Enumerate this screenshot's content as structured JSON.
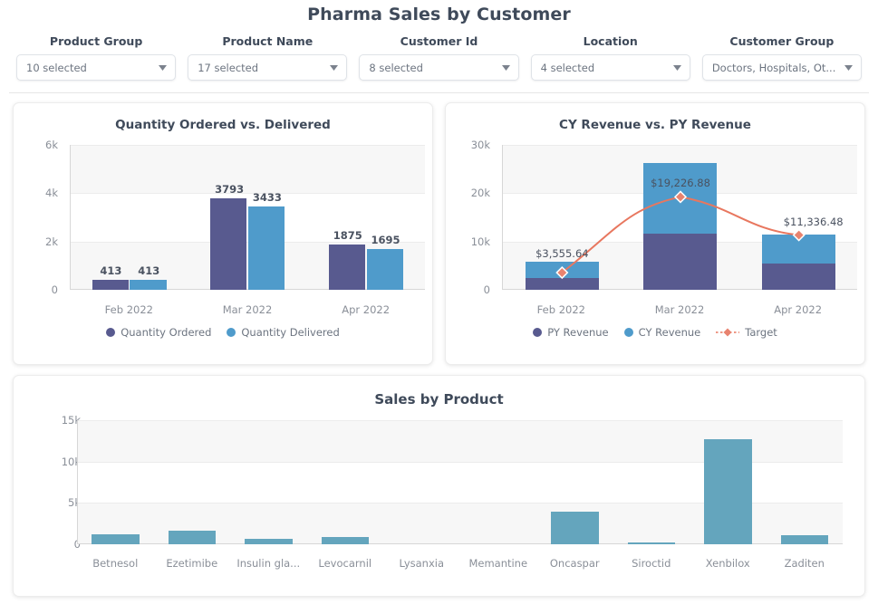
{
  "header": {
    "title": "Pharma Sales by Customer"
  },
  "filters": [
    {
      "label": "Product Group",
      "value": "10 selected",
      "icon": "chevron-down-icon"
    },
    {
      "label": "Product Name",
      "value": "17 selected",
      "icon": "chevron-down-icon"
    },
    {
      "label": "Customer Id",
      "value": "8 selected",
      "icon": "chevron-down-icon"
    },
    {
      "label": "Location",
      "value": "4 selected",
      "icon": "chevron-down-icon"
    },
    {
      "label": "Customer Group",
      "value": "Doctors, Hospitals, Ot...",
      "icon": "chevron-down-icon"
    }
  ],
  "colors": {
    "purple": "#585a8f",
    "blue": "#4f9bcb",
    "teal": "#64a5bd",
    "target": "#e8775f",
    "title": "#3f4a5a",
    "axis": "#8a8f98",
    "band": "#f7f7f7"
  },
  "chart_data": [
    {
      "type": "bar",
      "id": "quantity-ordered-vs-delivered",
      "title": "Quantity Ordered vs. Delivered",
      "xlabel": "",
      "ylabel": "",
      "ylim": [
        0,
        6000
      ],
      "yticks": [
        0,
        2000,
        4000,
        6000
      ],
      "ytick_labels": [
        "0",
        "2k",
        "4k",
        "6k"
      ],
      "grid": true,
      "legend_position": "bottom",
      "categories": [
        "Feb 2022",
        "Mar 2022",
        "Apr 2022"
      ],
      "series": [
        {
          "name": "Quantity Ordered",
          "color": "#585a8f",
          "values": [
            413,
            3793,
            1875
          ],
          "labels": [
            "413",
            "3793",
            "1875"
          ]
        },
        {
          "name": "Quantity Delivered",
          "color": "#4f9bcb",
          "values": [
            413,
            3433,
            1695
          ],
          "labels": [
            "413",
            "3433",
            "1695"
          ]
        }
      ]
    },
    {
      "type": "bar",
      "id": "cy-revenue-vs-py-revenue",
      "title": "CY Revenue vs. PY Revenue",
      "stacked": true,
      "xlabel": "",
      "ylabel": "",
      "ylim": [
        0,
        30000
      ],
      "yticks": [
        0,
        10000,
        20000,
        30000
      ],
      "ytick_labels": [
        "0",
        "10k",
        "20k",
        "30k"
      ],
      "grid": true,
      "legend_position": "bottom",
      "categories": [
        "Feb 2022",
        "Mar 2022",
        "Apr 2022"
      ],
      "series": [
        {
          "name": "PY Revenue",
          "color": "#585a8f",
          "values": [
            2400,
            11700,
            5500
          ]
        },
        {
          "name": "CY Revenue",
          "color": "#4f9bcb",
          "values": [
            3500,
            14500,
            5900
          ]
        },
        {
          "name": "Target",
          "color": "#e8775f",
          "type": "line",
          "marker": "diamond",
          "values": [
            3555.64,
            19226.88,
            11336.48
          ],
          "labels": [
            "$3,555.64",
            "$19,226.88",
            "$11,336.48"
          ]
        }
      ]
    },
    {
      "type": "bar",
      "id": "sales-by-product",
      "title": "Sales by Product",
      "xlabel": "",
      "ylabel": "",
      "ylim": [
        0,
        15000
      ],
      "yticks": [
        0,
        5000,
        10000,
        15000
      ],
      "ytick_labels": [
        "0",
        "5k",
        "10k",
        "15k"
      ],
      "grid": true,
      "legend_position": "none",
      "categories": [
        "Betnesol",
        "Ezetimibe",
        "Insulin gla...",
        "Levocarnil",
        "Lysanxia",
        "Memantine",
        "Oncaspar",
        "Siroctid",
        "Xenbilox",
        "Zaditen"
      ],
      "series": [
        {
          "name": "Sales",
          "color": "#64a5bd",
          "values": [
            1250,
            1650,
            650,
            900,
            0,
            0,
            3950,
            230,
            12650,
            1100
          ]
        }
      ]
    }
  ]
}
